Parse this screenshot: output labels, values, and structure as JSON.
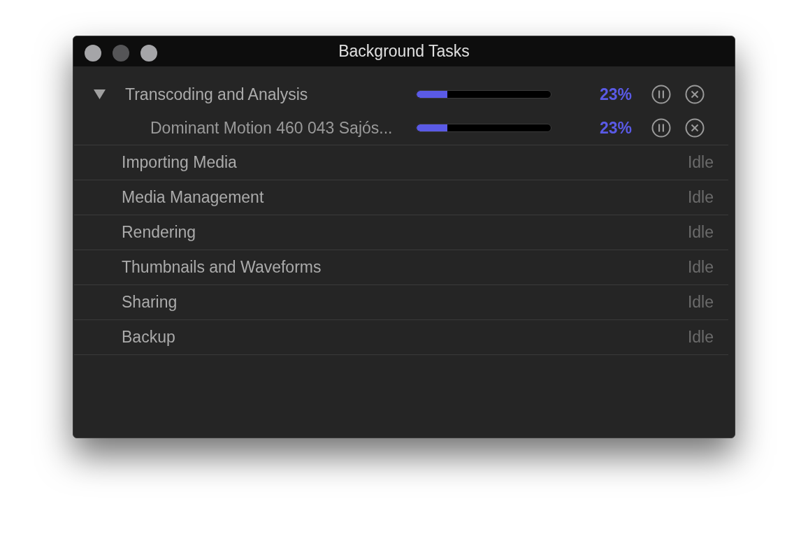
{
  "window": {
    "title": "Background Tasks"
  },
  "tasks": [
    {
      "kind": "progress",
      "name": "Transcoding and Analysis",
      "expanded": true,
      "level": 0.23,
      "percent": "23%",
      "children": [
        {
          "kind": "progress",
          "name": "Dominant Motion 460 043 Sajós...",
          "level": 0.23,
          "percent": "23%"
        }
      ]
    },
    {
      "kind": "idle",
      "name": "Importing Media",
      "status": "Idle"
    },
    {
      "kind": "idle",
      "name": "Media Management",
      "status": "Idle"
    },
    {
      "kind": "idle",
      "name": "Rendering",
      "status": "Idle"
    },
    {
      "kind": "idle",
      "name": "Thumbnails and Waveforms",
      "status": "Idle"
    },
    {
      "kind": "idle",
      "name": "Sharing",
      "status": "Idle"
    },
    {
      "kind": "idle",
      "name": "Backup",
      "status": "Idle"
    }
  ]
}
